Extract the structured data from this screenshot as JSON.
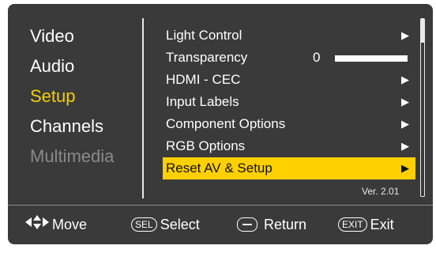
{
  "left_menu": {
    "items": [
      {
        "label": "Video",
        "state": "normal"
      },
      {
        "label": "Audio",
        "state": "normal"
      },
      {
        "label": "Setup",
        "state": "active"
      },
      {
        "label": "Channels",
        "state": "normal"
      },
      {
        "label": "Multimedia",
        "state": "disabled"
      }
    ]
  },
  "setup_menu": {
    "items": [
      {
        "label": "Light Control",
        "icon": "arrow-right-icon"
      },
      {
        "label": "Transparency",
        "value": "0",
        "level": 0
      },
      {
        "label": "HDMI - CEC",
        "icon": "arrow-right-icon"
      },
      {
        "label": "Input Labels",
        "icon": "arrow-right-icon"
      },
      {
        "label": "Component Options",
        "icon": "arrow-right-icon"
      },
      {
        "label": "RGB Options",
        "icon": "arrow-right-icon"
      },
      {
        "label": "Reset AV & Setup",
        "icon": "arrow-right-icon",
        "selected": true
      }
    ]
  },
  "version": "Ver. 2.01",
  "footer": {
    "move": {
      "icon": "nav-arrows-icon",
      "label": "Move"
    },
    "select": {
      "key": "SEL",
      "label": "Select"
    },
    "return": {
      "icon": "minus-button-icon",
      "label": "Return"
    },
    "exit": {
      "key": "EXIT",
      "label": "Exit"
    }
  },
  "colors": {
    "background": "#3a3a3a",
    "highlight": "#ffd000",
    "active_text": "#f4d000",
    "disabled_text": "#8a8a8a"
  }
}
